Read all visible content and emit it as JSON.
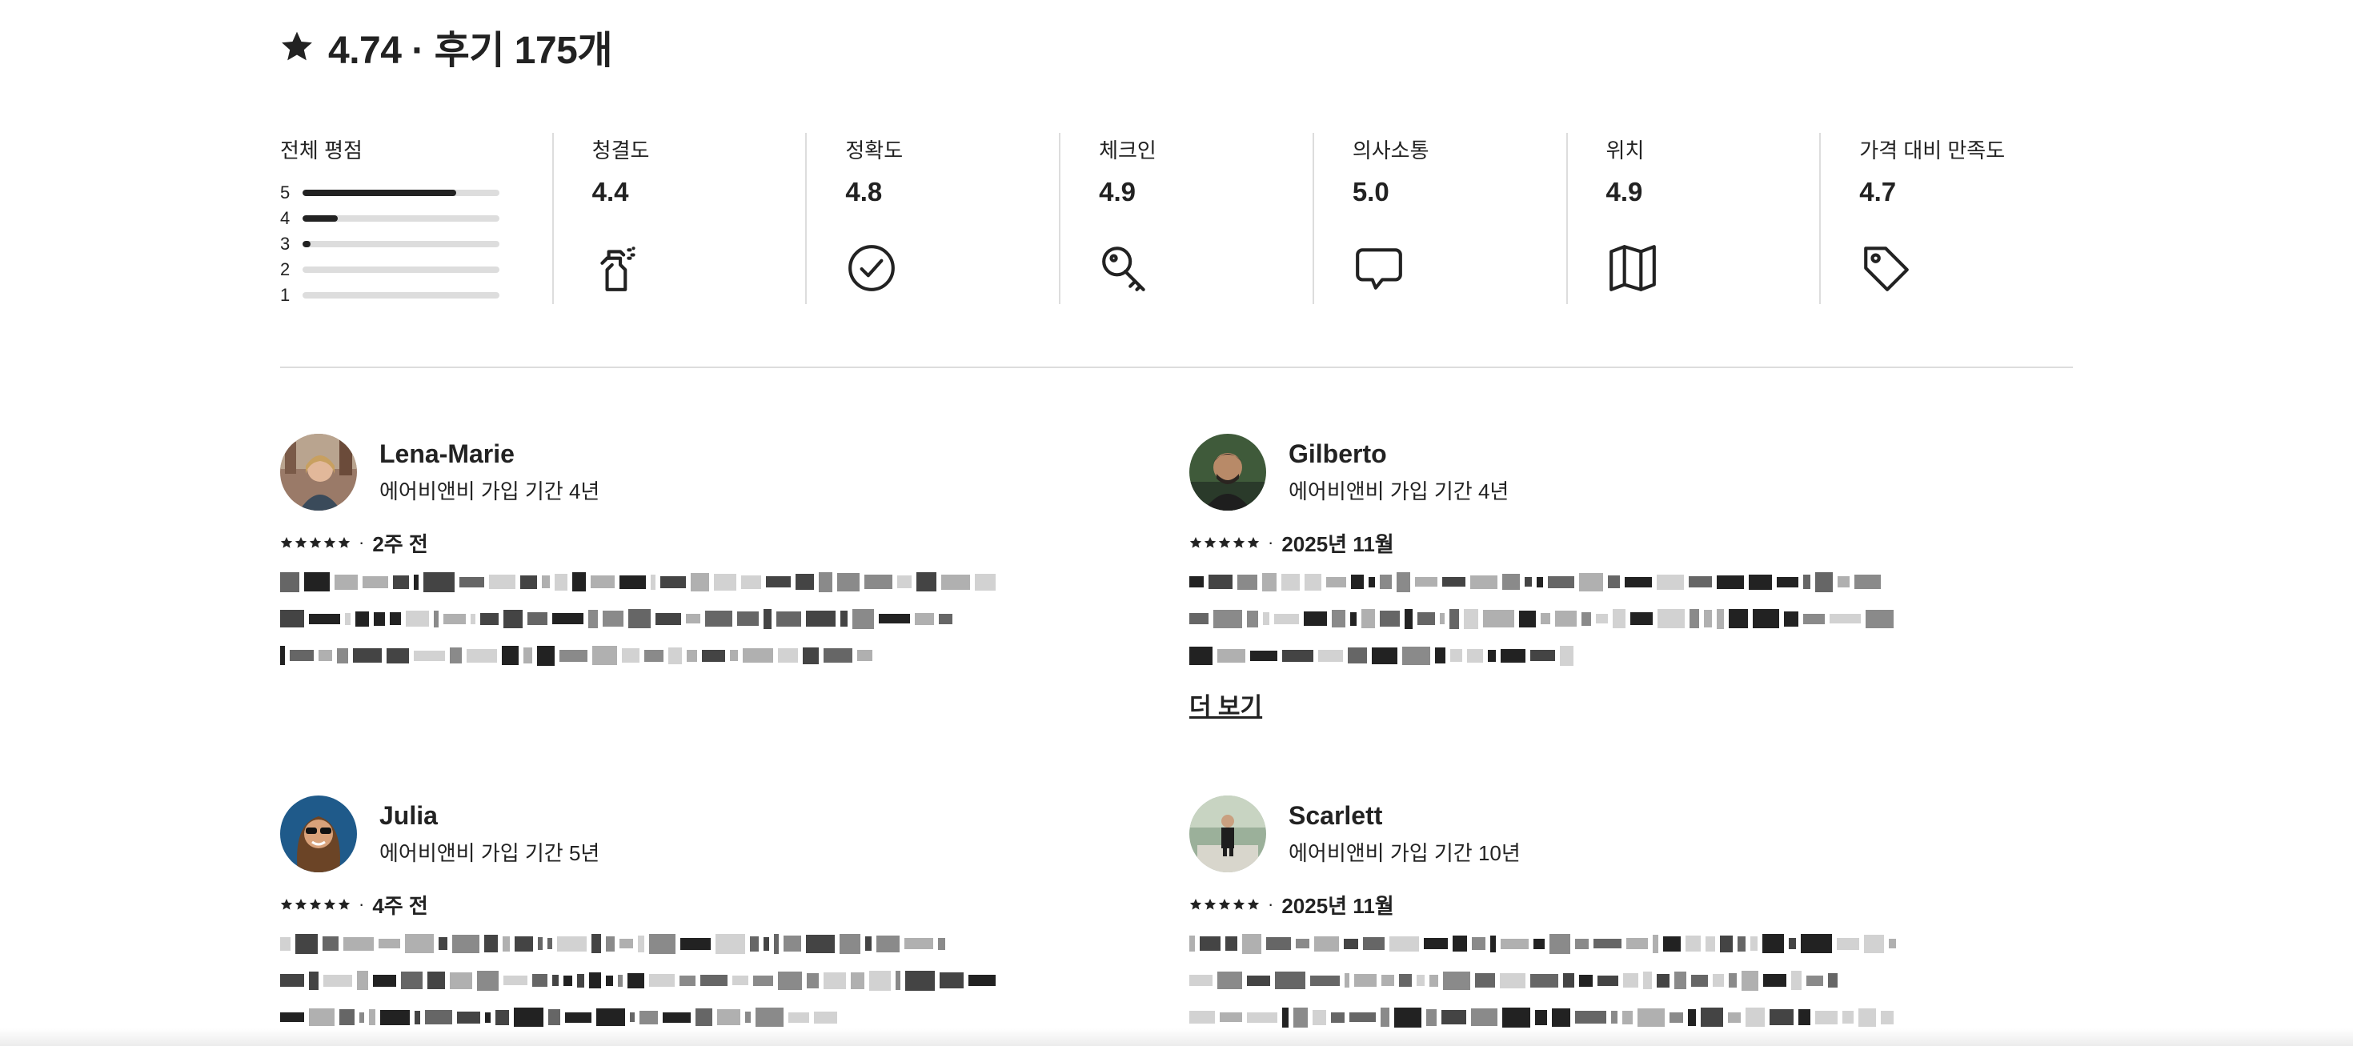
{
  "header": {
    "rating": "4.74",
    "separator": "·",
    "reviews": "후기 175개"
  },
  "overall": {
    "label": "전체 평점",
    "distribution": [
      {
        "stars": "5",
        "fraction": 0.78
      },
      {
        "stars": "4",
        "fraction": 0.18
      },
      {
        "stars": "3",
        "fraction": 0.04
      },
      {
        "stars": "2",
        "fraction": 0.0
      },
      {
        "stars": "1",
        "fraction": 0.0
      }
    ]
  },
  "categories": [
    {
      "label": "청결도",
      "value": "4.4",
      "icon": "spray-bottle-icon"
    },
    {
      "label": "정확도",
      "value": "4.8",
      "icon": "check-circle-icon"
    },
    {
      "label": "체크인",
      "value": "4.9",
      "icon": "key-icon"
    },
    {
      "label": "의사소통",
      "value": "5.0",
      "icon": "chat-bubble-icon"
    },
    {
      "label": "위치",
      "value": "4.9",
      "icon": "map-icon"
    },
    {
      "label": "가격 대비 만족도",
      "value": "4.7",
      "icon": "price-tag-icon"
    }
  ],
  "reviews": [
    {
      "name": "Lena-Marie",
      "membership": "에어비앤비 가입 기간 4년",
      "stars": 5,
      "date": "2주 전",
      "more": ""
    },
    {
      "name": "Gilberto",
      "membership": "에어비앤비 가입 기간 4년",
      "stars": 5,
      "date": "2025년 11월",
      "more": "더 보기"
    },
    {
      "name": "Julia",
      "membership": "에어비앤비 가입 기간 5년",
      "stars": 5,
      "date": "4주 전",
      "more": ""
    },
    {
      "name": "Scarlett",
      "membership": "에어비앤비 가입 기간 10년",
      "stars": 5,
      "date": "2025년 11월",
      "more": ""
    }
  ],
  "colors": {
    "text": "#222222",
    "divider": "#dddddd",
    "barTrack": "#dddddd",
    "barFill": "#222222"
  }
}
